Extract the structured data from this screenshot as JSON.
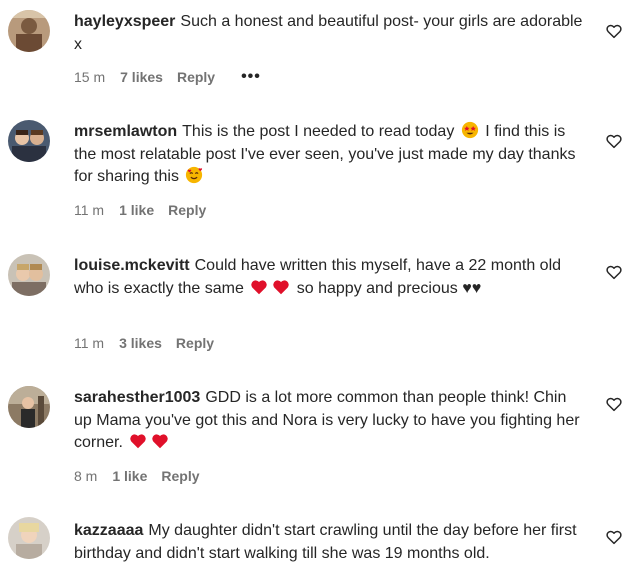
{
  "comments": [
    {
      "username": "hayleyxspeer",
      "text": "Such a honest and beautiful post- your girls are adorable x",
      "time": "15 m",
      "likes": "7 likes",
      "reply": "Reply",
      "more": "•••"
    },
    {
      "username": "mrsemlawton",
      "text_1": "This is the post I needed to read today",
      "text_2": "I find this is the most relatable post I've ever seen, you've just made my day thanks for sharing this",
      "time": "11 m",
      "likes": "1 like",
      "reply": "Reply"
    },
    {
      "username": "louise.mckevitt",
      "text_1": "Could have written this myself, have a 22 month old who is exactly the same",
      "text_2": "so happy and precious ♥♥",
      "time": "11 m",
      "likes": "3 likes",
      "reply": "Reply"
    },
    {
      "username": "sarahesther1003",
      "text": "GDD is a lot more common than people think! Chin up Mama you've got this and Nora is very lucky to have you fighting her corner.",
      "time": "8 m",
      "likes": "1 like",
      "reply": "Reply"
    },
    {
      "username": "kazzaaaa",
      "text": "My daughter didn't start crawling until the day before her first birthday and didn't start walking till she was 19 months old."
    }
  ],
  "colors": {
    "text": "#262626",
    "meta": "#737373",
    "emoji_heart": "#e0102a"
  },
  "icons": [
    "heart-outline-icon",
    "star-struck-emoji-icon",
    "smiling-hearts-emoji-icon",
    "red-heart-emoji-icon"
  ]
}
